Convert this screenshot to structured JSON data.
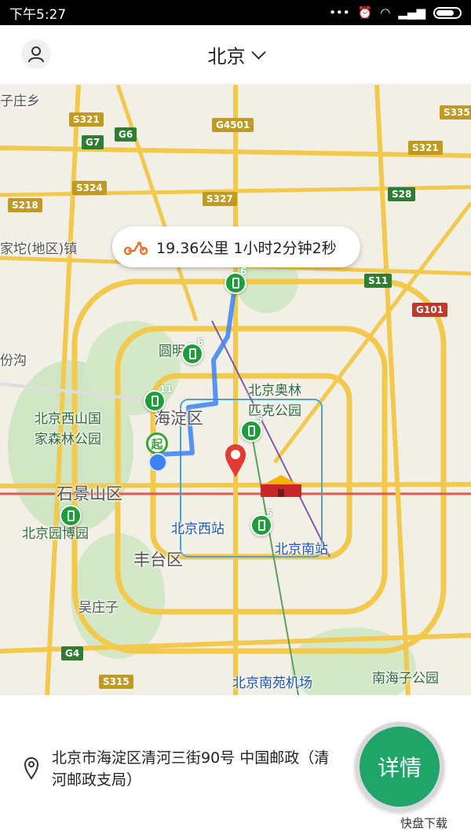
{
  "status_bar": {
    "time": "下午5:27",
    "dots": "•••"
  },
  "header": {
    "city": "北京"
  },
  "map": {
    "route_summary": "19.36公里 1小时2分钟2秒",
    "place_labels": [
      "子庄乡",
      "家坨(地区)镇",
      "份沟",
      "圆明",
      "北京西山国",
      "家森林公园",
      "海淀区",
      "北京奥林",
      "匹克公园",
      "石景山区",
      "北京园博园",
      "北京西站",
      "北京南站",
      "丰台区",
      "吴庄子",
      "北京南苑机场",
      "南海子公园"
    ],
    "road_shields": [
      "S321",
      "G4501",
      "S335",
      "G7",
      "G6",
      "S321",
      "S324",
      "S327",
      "S28",
      "S218",
      "S11",
      "G101",
      "G4",
      "S315"
    ],
    "station_counts": [
      "6",
      "6",
      "11",
      "5",
      "5"
    ],
    "start_marker": "起"
  },
  "panel": {
    "address": "北京市海淀区清河三街90号 中国邮政（清河邮政支局）",
    "details_label": "详情",
    "watermark": "快盘下载"
  }
}
